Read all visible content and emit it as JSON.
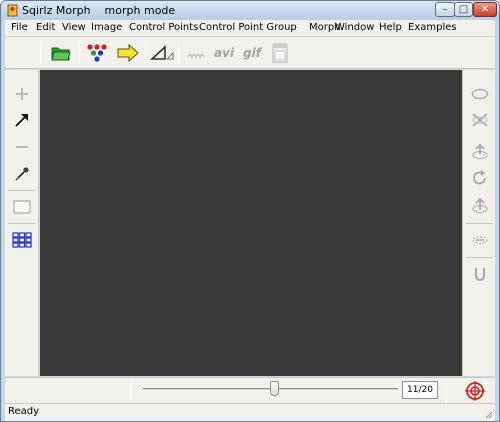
{
  "window": {
    "title": "Sqirlz Morph    morph mode",
    "minimize_label": "–",
    "maximize_label": "□",
    "close_label": "✕"
  },
  "menu": {
    "items": [
      "File",
      "Edit",
      "View",
      "Image",
      "Control Points",
      "Control Point Group",
      "Morph",
      "Window",
      "Help",
      "Examples"
    ]
  },
  "toolbar": {
    "buttons": [
      {
        "icon": "open-folder-icon",
        "enabled": true
      },
      {
        "icon": "control-points-icon",
        "enabled": true
      },
      {
        "icon": "next-arrow-icon",
        "enabled": true
      },
      {
        "icon": "triangle-mode-icon",
        "enabled": true
      },
      {
        "icon": "wave-icon",
        "enabled": false
      },
      {
        "icon": "avi-export-icon",
        "enabled": false
      },
      {
        "icon": "gif-export-icon",
        "enabled": false
      },
      {
        "icon": "film-frames-icon",
        "enabled": false
      }
    ],
    "avi_label": "avi",
    "gif_label": "gif"
  },
  "left_tools": [
    {
      "icon": "add-icon",
      "enabled": false
    },
    {
      "icon": "arrow-up-right-icon",
      "enabled": true
    },
    {
      "icon": "subtract-icon",
      "enabled": false
    },
    {
      "icon": "eyedropper-icon",
      "enabled": true
    },
    {
      "icon": "rectangle-icon",
      "enabled": false
    },
    {
      "icon": "grid-icon",
      "enabled": true
    }
  ],
  "right_tools": [
    {
      "icon": "ellipse-icon",
      "enabled": false
    },
    {
      "icon": "cross-icon",
      "enabled": false
    },
    {
      "icon": "rotate-up-icon",
      "enabled": false
    },
    {
      "icon": "rotate-clockwise-icon",
      "enabled": false
    },
    {
      "icon": "move-up-icon",
      "enabled": false
    },
    {
      "icon": "squash-icon",
      "enabled": false
    },
    {
      "icon": "u-shape-icon",
      "enabled": false
    }
  ],
  "timeline": {
    "frame_label": "11/20",
    "current_frame": 11,
    "total_frames": 20
  },
  "status": {
    "text": "Ready"
  },
  "colors": {
    "canvas": "#3a3a3a",
    "panel": "#f3f1ec",
    "accent_red": "#cc2222",
    "accent_blue": "#2233cc"
  }
}
